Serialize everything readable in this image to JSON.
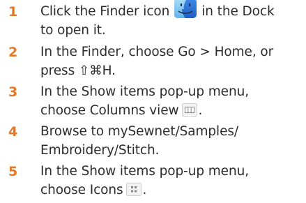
{
  "colors": {
    "accent": "#e37826",
    "ink": "#2c2c2c",
    "finder_dark": "#2d77d8",
    "finder_light": "#8ecbf2"
  },
  "steps": [
    {
      "number": "1",
      "line1_pre": "Click the Finder icon",
      "line1_icon": "finder-icon",
      "line1_post": "in the Dock",
      "line2": "to open it."
    },
    {
      "number": "2",
      "line1": "In the Finder, choose Go > Home, or",
      "line2": "press ⇧⌘H."
    },
    {
      "number": "3",
      "line1": "In the Show items pop-up menu,",
      "line2_pre": "choose Columns view",
      "line2_icon": "columns-view-icon",
      "line2_post": "."
    },
    {
      "number": "4",
      "line1": "Browse to mySewnet/Samples/",
      "line2": "Embroidery/Stitch."
    },
    {
      "number": "5",
      "line1": "In the Show items pop-up menu,",
      "line2_pre": "choose Icons",
      "line2_icon": "icons-view-icon",
      "line2_post": "."
    }
  ]
}
